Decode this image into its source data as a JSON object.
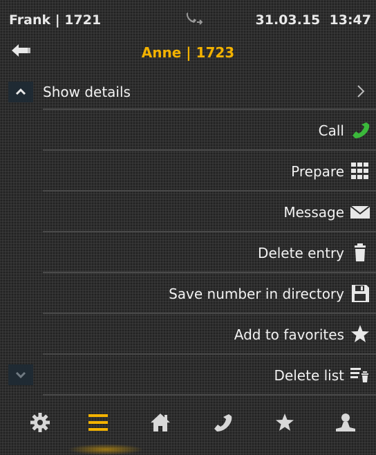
{
  "status": {
    "user": "Frank | 1721",
    "date": "31.03.15",
    "time": "13:47"
  },
  "header": {
    "title": "Anne | 1723"
  },
  "menu": {
    "items": [
      {
        "label": "Show details",
        "icon": "chevron-right-icon"
      },
      {
        "label": "Call",
        "icon": "phone-icon"
      },
      {
        "label": "Prepare",
        "icon": "keypad-icon"
      },
      {
        "label": "Message",
        "icon": "envelope-icon"
      },
      {
        "label": "Delete entry",
        "icon": "trash-icon"
      },
      {
        "label": "Save number in directory",
        "icon": "floppy-disk-icon"
      },
      {
        "label": "Add to favorites",
        "icon": "star-icon"
      },
      {
        "label": "Delete list",
        "icon": "delete-list-icon"
      }
    ]
  },
  "nav": [
    "settings-icon",
    "menu-icon",
    "home-icon",
    "phone-icon",
    "star-icon",
    "person-icon"
  ],
  "colors": {
    "accent": "#f3b200",
    "call_green": "#3bb83b",
    "background": "#2e2e2e",
    "divider": "#4a4a4a",
    "scroll_button": "#1f2a33"
  }
}
